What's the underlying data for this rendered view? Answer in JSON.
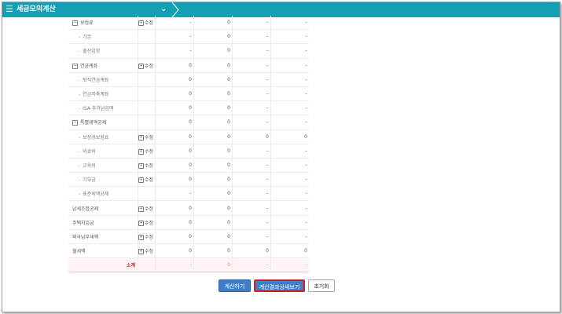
{
  "header": {
    "menu_icon": "☰",
    "title": "세금모의계산",
    "chevron": "⌄"
  },
  "table": {
    "rows": [
      {
        "kind": "section",
        "name": "보험료",
        "action": "수정",
        "values": [
          "–",
          "0",
          "–",
          "–"
        ]
      },
      {
        "kind": "child",
        "name": "기본",
        "action": "",
        "values": [
          "–",
          "0",
          "–",
          "–"
        ]
      },
      {
        "kind": "child",
        "name": "출산입양",
        "action": "",
        "values": [
          "–",
          "0",
          "–",
          "–"
        ]
      },
      {
        "kind": "section",
        "name": "연금계좌",
        "action": "수정",
        "values": [
          "0",
          "0",
          "–",
          "–"
        ]
      },
      {
        "kind": "child",
        "name": "퇴직연금계좌",
        "action": "",
        "values": [
          "0",
          "0",
          "–",
          "–"
        ]
      },
      {
        "kind": "child",
        "name": "연금저축계좌",
        "action": "",
        "values": [
          "0",
          "0",
          "–",
          "–"
        ]
      },
      {
        "kind": "child",
        "name": "ISA 추가납입액",
        "action": "",
        "values": [
          "0",
          "0",
          "–",
          "–"
        ]
      },
      {
        "kind": "section",
        "name": "특별세액공제",
        "action": "",
        "values": [
          "0",
          "0",
          "–",
          "–"
        ]
      },
      {
        "kind": "child",
        "name": "보장성보험료",
        "action": "수정",
        "values": [
          "0",
          "0",
          "0",
          "0"
        ]
      },
      {
        "kind": "child",
        "name": "의료비",
        "action": "수정",
        "values": [
          "0",
          "0",
          "–",
          "–"
        ]
      },
      {
        "kind": "child",
        "name": "교육비",
        "action": "수정",
        "values": [
          "0",
          "0",
          "–",
          "–"
        ]
      },
      {
        "kind": "child",
        "name": "기부금",
        "action": "수정",
        "values": [
          "0",
          "0",
          "–",
          "–"
        ]
      },
      {
        "kind": "child",
        "name": "표준세액공제",
        "action": "",
        "values": [
          "–",
          "0",
          "–",
          "–"
        ]
      },
      {
        "kind": "plain",
        "name": "납세조합공제",
        "action": "수정",
        "values": [
          "0",
          "0",
          "–",
          "–"
        ]
      },
      {
        "kind": "plain",
        "name": "주택차입금",
        "action": "수정",
        "values": [
          "0",
          "0",
          "–",
          "–"
        ]
      },
      {
        "kind": "plain",
        "name": "외국납부세액",
        "action": "수정",
        "values": [
          "0",
          "0",
          "–",
          "–"
        ]
      },
      {
        "kind": "plain",
        "name": "월세액",
        "action": "수정",
        "values": [
          "0",
          "0",
          "0",
          "0"
        ]
      },
      {
        "kind": "subtotal",
        "name": "소계",
        "action": "",
        "values": [
          "–",
          "0",
          "–",
          "–"
        ]
      }
    ]
  },
  "buttons": {
    "calculate": "계산하기",
    "detail": "계산결과상세보기",
    "reset": "초기화"
  },
  "colors": {
    "header_bg": "#14a0b4",
    "button_blue": "#3f7fc9",
    "highlight_red": "#c81e2b"
  }
}
